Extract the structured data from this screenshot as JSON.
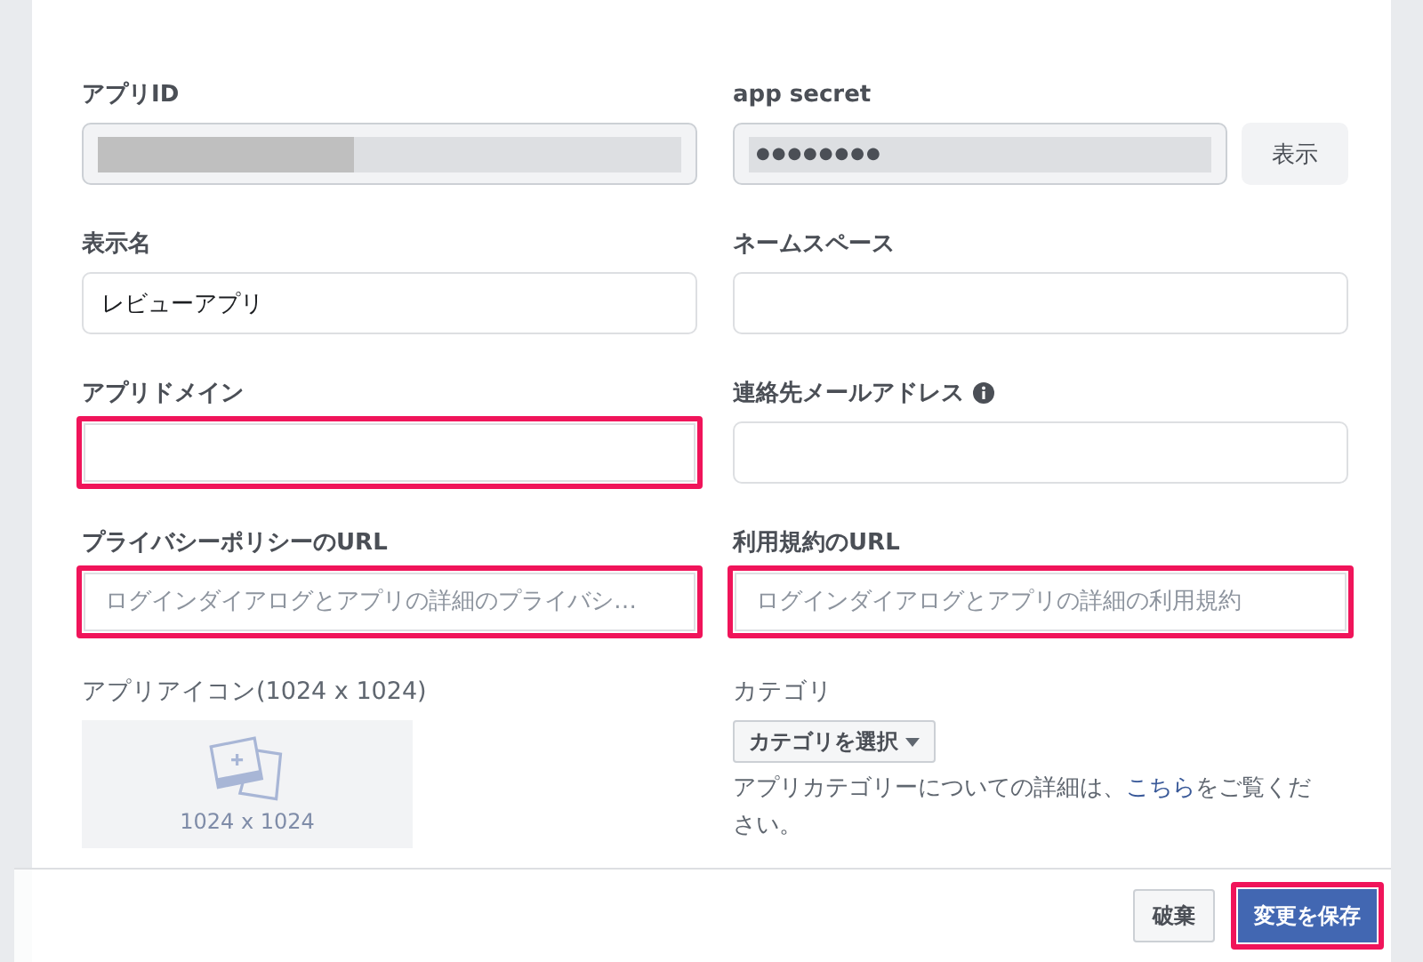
{
  "fields": [
    {
      "kind": "redacted",
      "label": "アプリID",
      "highlighted": false
    },
    {
      "kind": "secret",
      "label": "app secret",
      "value": "●●●●●●●●",
      "button": "表示",
      "highlighted": false
    },
    {
      "kind": "input",
      "label": "表示名",
      "value": "レビューアプリ",
      "highlighted": false
    },
    {
      "kind": "input",
      "label": "ネームスペース",
      "highlighted": false
    },
    {
      "kind": "input",
      "label": "アプリドメイン",
      "highlighted": true
    },
    {
      "kind": "input",
      "label": "連絡先メールアドレス",
      "info": true,
      "highlighted": false
    },
    {
      "kind": "input",
      "label": "プライバシーポリシーのURL",
      "placeholder": "ログインダイアログとアプリの詳細のプライバシ…",
      "highlighted": true
    },
    {
      "kind": "input",
      "label": "利用規約のURL",
      "placeholder": "ログインダイアログとアプリの詳細の利用規約",
      "highlighted": true
    },
    {
      "kind": "image",
      "label": "アプリアイコン(1024 x 1024)",
      "caption": "1024 x 1024"
    },
    {
      "kind": "category",
      "label": "カテゴリ",
      "button": "カテゴリを選択",
      "help_before": "アプリカテゴリーについての詳細は、",
      "link": "こちら",
      "help_after": "をご覧ください。"
    }
  ],
  "footer": {
    "buttons": [
      {
        "label": "破棄",
        "kind": "secondary",
        "highlighted": false
      },
      {
        "label": "変更を保存",
        "kind": "primary",
        "highlighted": true
      }
    ]
  }
}
